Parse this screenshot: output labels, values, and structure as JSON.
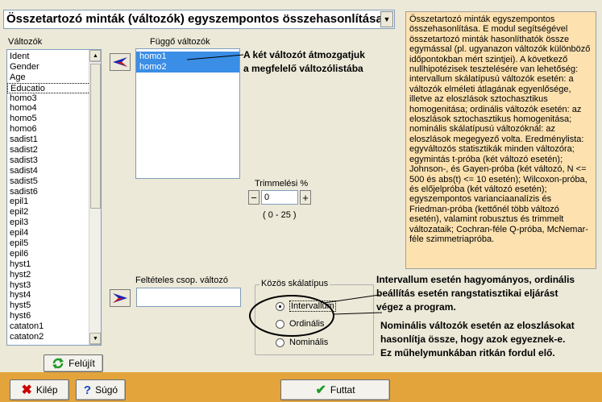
{
  "window": {
    "module_title": "Összetartozó minták (változók) egyszempontos összehasonlítása"
  },
  "description": "Összetartozó minták egyszempontos összehasonlítása. E modul segítségével összetartozó minták hasonlíthatók össze egymással (pl. ugyanazon változók különböző időpontokban mért szintjei). A következő nullhipotézisek tesztelésére van lehetőség: intervallum skálatípusú változók esetén: a változók elméleti átlagának egyenlősége, illetve az eloszlások sztochasztikus homogenitása; ordinális változók esetén: az eloszlások sztochasztikus homogenitása; nominális skálatípusú változóknál: az eloszlások megegyező volta. Eredménylista: egyváltozós statisztikák minden változóra; egymintás t-próba (két változó esetén); Johnson-, és Gayen-próba (két változó, N <= 500 és abs(t) <= 10 esetén); Wilcoxon-próba, és előjelpróba (két változó esetén); egyszempontos varianciaanalízis és Friedman-próba (kettőnél több változó esetén), valamint robusztus és trimmelt változataik; Cochran-féle Q-próba, McNemar-féle szimmetriapróba.",
  "variables": {
    "label": "Változók",
    "items": [
      "Ident",
      "Gender",
      "Age",
      "Educatio",
      "homo3",
      "homo4",
      "homo5",
      "homo6",
      "sadist1",
      "sadist2",
      "sadist3",
      "sadist4",
      "sadist5",
      "sadist6",
      "epil1",
      "epil2",
      "epil3",
      "epil4",
      "epil5",
      "epil6",
      "hyst1",
      "hyst2",
      "hyst3",
      "hyst4",
      "hyst5",
      "hyst6",
      "cataton1",
      "cataton2"
    ],
    "focused_index": 3
  },
  "dependent": {
    "label": "Függő változók",
    "items": [
      "homo1",
      "homo2"
    ]
  },
  "annotations": {
    "move": [
      "A két változót átmozgatjuk",
      "a megfelelő változólistába"
    ],
    "interval": [
      "Intervallum esetén hagyományos, ordinális",
      "beállítás esetén rangstatisztikai eljárást",
      "végez a program."
    ],
    "nominal": [
      "Nominális változók esetén az eloszlásokat",
      "hasonlítja össze, hogy azok egyeznek-e.",
      "Ez műhelymunkában ritkán fordul elő."
    ]
  },
  "trim": {
    "label": "Trimmelési %",
    "value": "0",
    "range": "( 0 - 25 )",
    "minus": "−",
    "plus": "+"
  },
  "conditional": {
    "label": "Feltételes csop. változó",
    "value": ""
  },
  "scale": {
    "label": "Közös skálatípus",
    "options": [
      "Intervallum",
      "Ordinális",
      "Nominális"
    ],
    "selected_index": 0
  },
  "buttons": {
    "refresh": "Felújít",
    "exit": "Kilép",
    "help": "Súgó",
    "run": "Futtat"
  },
  "colors": {
    "accent_selection": "#3a8ee6",
    "description_bg": "#fde2b0",
    "bottom_bar": "#e3a43c",
    "arrow_blue": "#1a22b8",
    "arrow_red": "#d81818"
  }
}
